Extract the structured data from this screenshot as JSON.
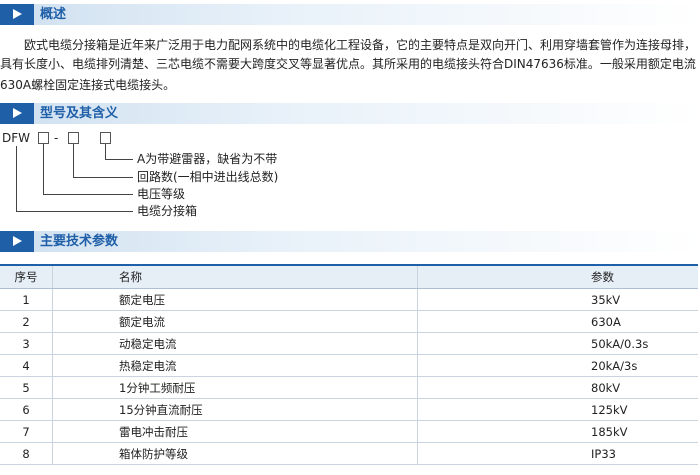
{
  "sections": {
    "overview": {
      "title": "概述"
    },
    "model": {
      "title": "型号及其含义"
    },
    "params": {
      "title": "主要技术参数"
    }
  },
  "overview_text": {
    "line1": "　　欧式电缆分接箱是近年来广泛用于电力配网系统中的电缆化工程设备，它的主要特点是双向开门、利用穿墙套管作为连接母排，",
    "line2": "具有长度小、电缆排列清楚、三芯电缆不需要大跨度交叉等显著优点。其所采用的电缆接头符合DIN47636标准。一般采用额定电流",
    "line3": "630A螺栓固定连接式电缆接头。"
  },
  "model_code": {
    "prefix": "DFW",
    "dash": "-",
    "labels": [
      "A为带避雷器，缺省为不带",
      "回路数(一相中进出线总数)",
      "电压等级",
      "电缆分接箱"
    ]
  },
  "table": {
    "headers": [
      "序号",
      "名称",
      "参数"
    ],
    "rows": [
      [
        "1",
        "额定电压",
        "35kV"
      ],
      [
        "2",
        "额定电流",
        "630A"
      ],
      [
        "3",
        "动稳定电流",
        "50kA/0.3s"
      ],
      [
        "4",
        "热稳定电流",
        "20kA/3s"
      ],
      [
        "5",
        "1分钟工频耐压",
        "80kV"
      ],
      [
        "6",
        "15分钟直流耐压",
        "125kV"
      ],
      [
        "7",
        "雷电冲击耐压",
        "185kV"
      ],
      [
        "8",
        "箱体防护等级",
        "IP33"
      ]
    ]
  },
  "colors": {
    "accent": "#1f5fa8",
    "header_bg": "#e6eef6"
  }
}
